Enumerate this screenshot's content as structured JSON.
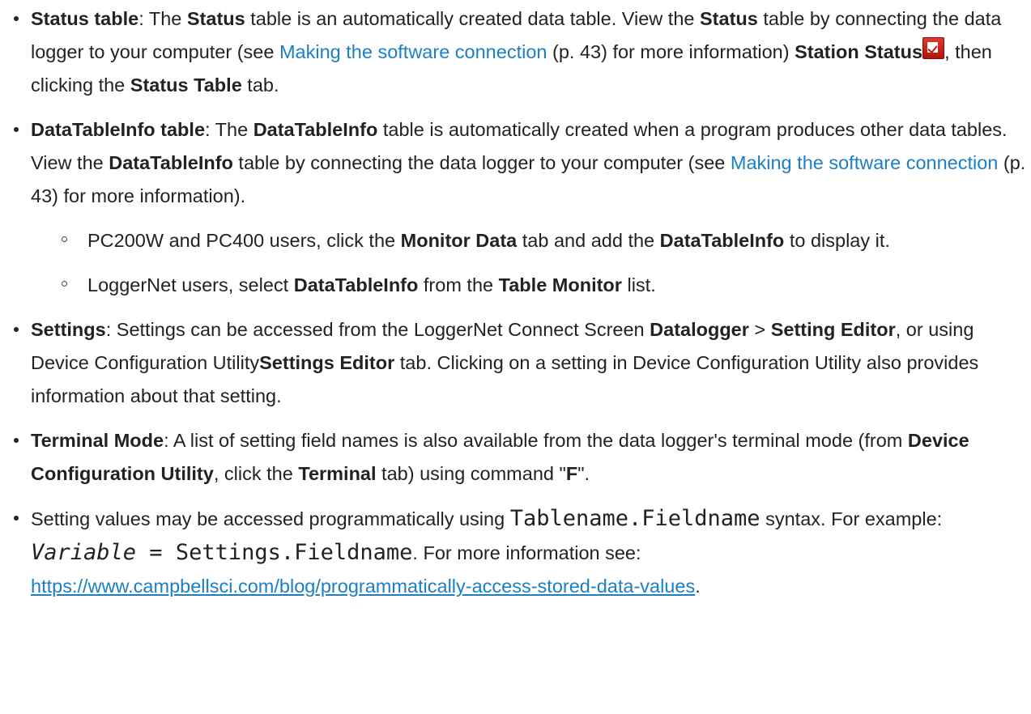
{
  "items": [
    {
      "term": "Status table",
      "p1": ": The ",
      "b1": "Status",
      "p2": " table is an automatically created data table. View the ",
      "b2": "Status",
      "p3": " table by connecting the data logger to your computer (see ",
      "link": "Making the software connection",
      "p4": " (p. 43) for more information) ",
      "b3": "Station Status",
      "icon": "station-status-icon",
      "p5": ", then clicking the ",
      "b4": "Status Table",
      "p6": " tab."
    },
    {
      "term": "DataTableInfo table",
      "p1": ": The ",
      "b1": "DataTableInfo",
      "p2": " table is automatically created when a program produces other data tables. View the ",
      "b2": "DataTableInfo",
      "p3": " table by connecting the data logger to your computer (see ",
      "link": "Making the software connection",
      "p4": " (p. 43) for more information).",
      "sub": [
        {
          "p1": "PC200W and PC400 users, click the ",
          "b1": "Monitor Data",
          "p2": " tab and add the ",
          "b2": "DataTableInfo",
          "p3": " to display it."
        },
        {
          "p1": "LoggerNet users, select ",
          "b1": "DataTableInfo",
          "p2": " from the ",
          "b2": "Table Monitor",
          "p3": " list."
        }
      ]
    },
    {
      "term": "Settings",
      "p1": ": Settings can be accessed from the LoggerNet Connect Screen ",
      "b1": "Datalogger",
      "p2": " > ",
      "b2": "Setting Editor",
      "p3": ", or using Device Configuration Utility",
      "b3": "Settings Editor",
      "p4": " tab. Clicking on a setting in Device Configuration Utility also provides information about that setting."
    },
    {
      "term": "Terminal Mode",
      "p1": ": A list of setting field names is also available from the data logger's terminal mode (from ",
      "b1": "Device Configuration Utility",
      "p2": ", click the ",
      "b2": "Terminal",
      "p3": " tab) using command \"",
      "b3": "F",
      "p4": "\"."
    },
    {
      "p1": "Setting values may be accessed programmatically using ",
      "code1": "Tablename.Fieldname",
      "p2": " syntax. For example: ",
      "code2": "Variable",
      "code3": " = Settings.Fieldname",
      "p3": ". For more information see: ",
      "url": "https://www.campbellsci.com/blog/programmatically-access-stored-data-values",
      "p4": "."
    }
  ],
  "colors": {
    "text": "#222222",
    "link": "#1a7fc4",
    "icon": "#d0241a"
  }
}
